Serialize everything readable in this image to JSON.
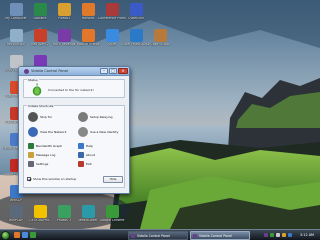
{
  "desktop": {
    "icons": [
      {
        "label": "My Computer",
        "icon": "computer-icon",
        "color": "#6f8fb8"
      },
      {
        "label": "Recycle Bin",
        "icon": "recycle-bin-icon",
        "color": "#8fb0c8"
      },
      {
        "label": "EMS Print 8.0",
        "icon": "printer-icon",
        "color": "#c0c4c8"
      },
      {
        "label": "Flash Header",
        "icon": "flash-icon",
        "color": "#d84a2a"
      },
      {
        "label": "FLASHPlayer",
        "icon": "flash-player-icon",
        "color": "#c8382a"
      },
      {
        "label": "Media Player Classic",
        "icon": "media-player-icon",
        "color": "#4a7ac8"
      },
      {
        "label": "Adobe Reader 8",
        "icon": "pdf-icon",
        "color": "#c22a22"
      },
      {
        "label": "WinSCP",
        "icon": "winscp-icon",
        "color": "#3a78c8"
      },
      {
        "label": "WinPCAP",
        "icon": "network-icon",
        "color": "#5a6a7a"
      },
      {
        "label": "Solitaire",
        "icon": "game-icon",
        "color": "#2a8a4a"
      },
      {
        "label": "GEOGRAPHIC",
        "icon": "nat-geo-icon",
        "color": "#f2c200"
      },
      {
        "label": "Picasa3",
        "icon": "picasa-icon",
        "color": "#d8a030"
      },
      {
        "label": "Red Alert 2",
        "icon": "game-icon",
        "color": "#c8402a"
      },
      {
        "label": "Yuri's Revenge",
        "icon": "game-icon",
        "color": "#7a3aa8"
      },
      {
        "label": "Photos 3",
        "icon": "photos-icon",
        "color": "#3aa060"
      },
      {
        "label": "Hotshot",
        "icon": "hotshot-icon",
        "color": "#e07a2a"
      },
      {
        "label": "Mozilla Firefox",
        "icon": "firefox-icon",
        "color": "#e2762a"
      },
      {
        "label": "Vuze",
        "icon": "vuze-icon",
        "color": "#3a8ae0"
      },
      {
        "label": "MediaCoder",
        "icon": "mediacoder-icon",
        "color": "#2a9aa8"
      },
      {
        "label": "Conference Planner",
        "icon": "document-icon",
        "color": "#a83a3a"
      },
      {
        "label": "CyberLink",
        "icon": "cyberlink-icon",
        "color": "#3a5ac8"
      },
      {
        "label": "Corel Photo Album 6",
        "icon": "corel-icon",
        "color": "#2a7ac8"
      },
      {
        "label": "Cake Studio",
        "icon": "cake-icon",
        "color": "#b87a3a"
      },
      {
        "label": "Google Chrome",
        "icon": "chrome-icon",
        "color": "#3a9a3a"
      },
      {
        "label": "Yahoo! Messenger",
        "icon": "messenger-icon",
        "color": "#7a3ab8"
      },
      {
        "label": "Tor Browser",
        "icon": "tor-icon",
        "color": "#6a3d8f"
      }
    ]
  },
  "window": {
    "title": "Vidalia Control Panel",
    "status_group": "Status",
    "status_text": "Connected to the Tor network!",
    "shortcuts_group": "Vidalia Shortcuts",
    "shortcuts": [
      {
        "label": "Stop Tor",
        "icon": "stop-icon",
        "color": "#555"
      },
      {
        "label": "Setup Relaying",
        "icon": "relay-icon",
        "color": "#7a7a7a"
      },
      {
        "label": "View the Network",
        "icon": "globe-icon",
        "color": "#3a6ab8"
      },
      {
        "label": "Use a New Identity",
        "icon": "identity-icon",
        "color": "#888"
      },
      {
        "label": "Bandwidth Graph",
        "icon": "graph-icon",
        "color": "#2a7a3a"
      },
      {
        "label": "Help",
        "icon": "help-icon",
        "color": "#3a78c8"
      },
      {
        "label": "Message Log",
        "icon": "log-icon",
        "color": "#c8a23a"
      },
      {
        "label": "About",
        "icon": "about-icon",
        "color": "#3a68a8"
      },
      {
        "label": "Settings",
        "icon": "settings-icon",
        "color": "#667"
      },
      {
        "label": "Exit",
        "icon": "exit-icon",
        "color": "#b83a2a"
      }
    ],
    "startup_label": "Show this window on startup",
    "startup_checked": true,
    "hide_label": "Hide"
  },
  "taskbar": {
    "tasks": [
      {
        "label": "Vidalia Control Panel",
        "active": false
      },
      {
        "label": "Vidalia Control Panel",
        "active": true
      }
    ],
    "clock": "3:12 AM"
  }
}
